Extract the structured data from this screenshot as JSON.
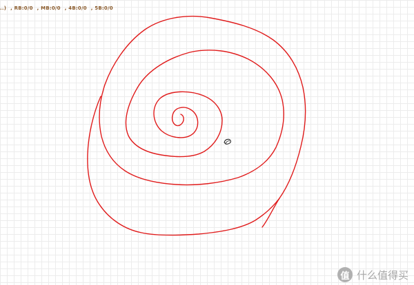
{
  "status_bar": {
    "items": [
      "..)",
      ", RB:0/0",
      ", MB:0/0",
      ", 4B:0/0",
      ", 5B:0/0"
    ]
  },
  "drawing": {
    "stroke_color": "#e01b1b",
    "background_color": "#ffffff",
    "grid_color": "#ececec"
  },
  "cursor": {
    "icon": "mouse-pointer-icon"
  },
  "watermark": {
    "logo_glyph": "值",
    "text": "什么值得买"
  }
}
